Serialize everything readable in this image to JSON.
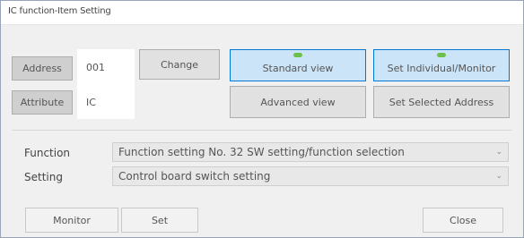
{
  "window": {
    "title": "IC function-Item Setting"
  },
  "address": {
    "button_label": "Address",
    "value": "001",
    "change_label": "Change"
  },
  "attribute": {
    "button_label": "Attribute",
    "value": "IC"
  },
  "views": {
    "standard_label": "Standard view",
    "individual_label": "Set Individual/Monitor",
    "advanced_label": "Advanced view",
    "selected_label": "Set Selected Address"
  },
  "form": {
    "function_label": "Function",
    "function_value": "Function setting No. 32 SW setting/function selection",
    "setting_label": "Setting",
    "setting_value": "Control board switch setting"
  },
  "footer": {
    "monitor_label": "Monitor",
    "set_label": "Set",
    "close_label": "Close"
  },
  "icons": {
    "dropdown": "chevron-down-icon",
    "indicator": "status-led-icon"
  },
  "colors": {
    "accent": "#0078d7",
    "selected_bg": "#cce4f7",
    "led": "#6cc04a"
  }
}
